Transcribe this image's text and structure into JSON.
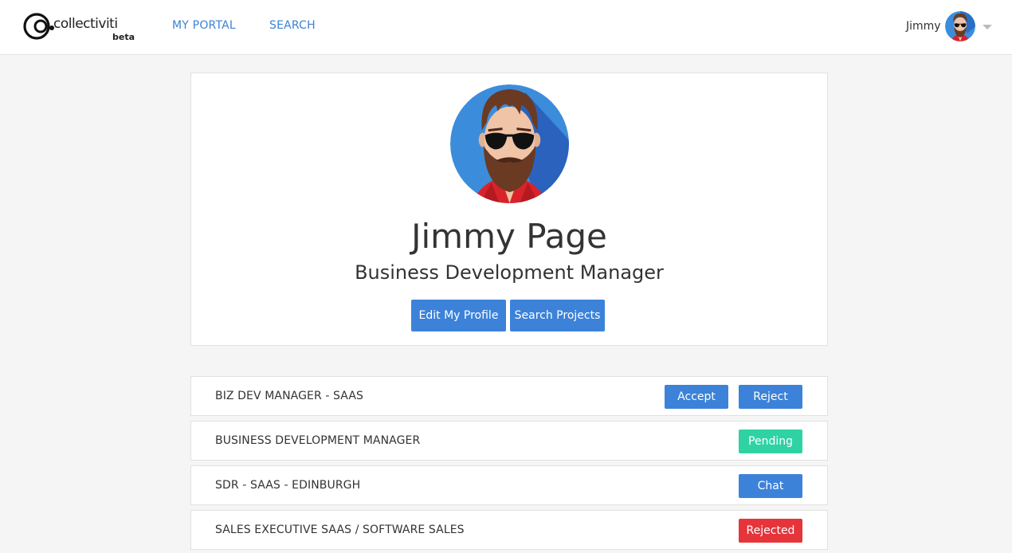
{
  "brand": {
    "name": "collectiviti",
    "tag": "beta"
  },
  "nav": {
    "portal_label": "MY PORTAL",
    "search_label": "SEARCH"
  },
  "user": {
    "short_name": "Jimmy"
  },
  "profile": {
    "full_name": "Jimmy Page",
    "job_title": "Business Development Manager",
    "edit_label": "Edit My Profile",
    "search_projects_label": "Search Projects"
  },
  "applications": [
    {
      "title": "BIZ DEV MANAGER - SAAS",
      "actions": [
        "Accept",
        "Reject"
      ]
    },
    {
      "title": "BUSINESS DEVELOPMENT MANAGER",
      "status": "Pending"
    },
    {
      "title": "SDR - SAAS - EDINBURGH",
      "status": "Chat"
    },
    {
      "title": "SALES EXECUTIVE SAAS / SOFTWARE SALES",
      "status": "Rejected"
    }
  ],
  "colors": {
    "primary": "#3c82d9",
    "pending": "#2fd3a3",
    "rejected": "#e5353b",
    "link": "#3c82d1"
  },
  "icons": {
    "logo": "collectiviti-logo-icon",
    "avatar": "bearded-man-sunglasses-avatar",
    "caret": "caret-down-icon"
  }
}
